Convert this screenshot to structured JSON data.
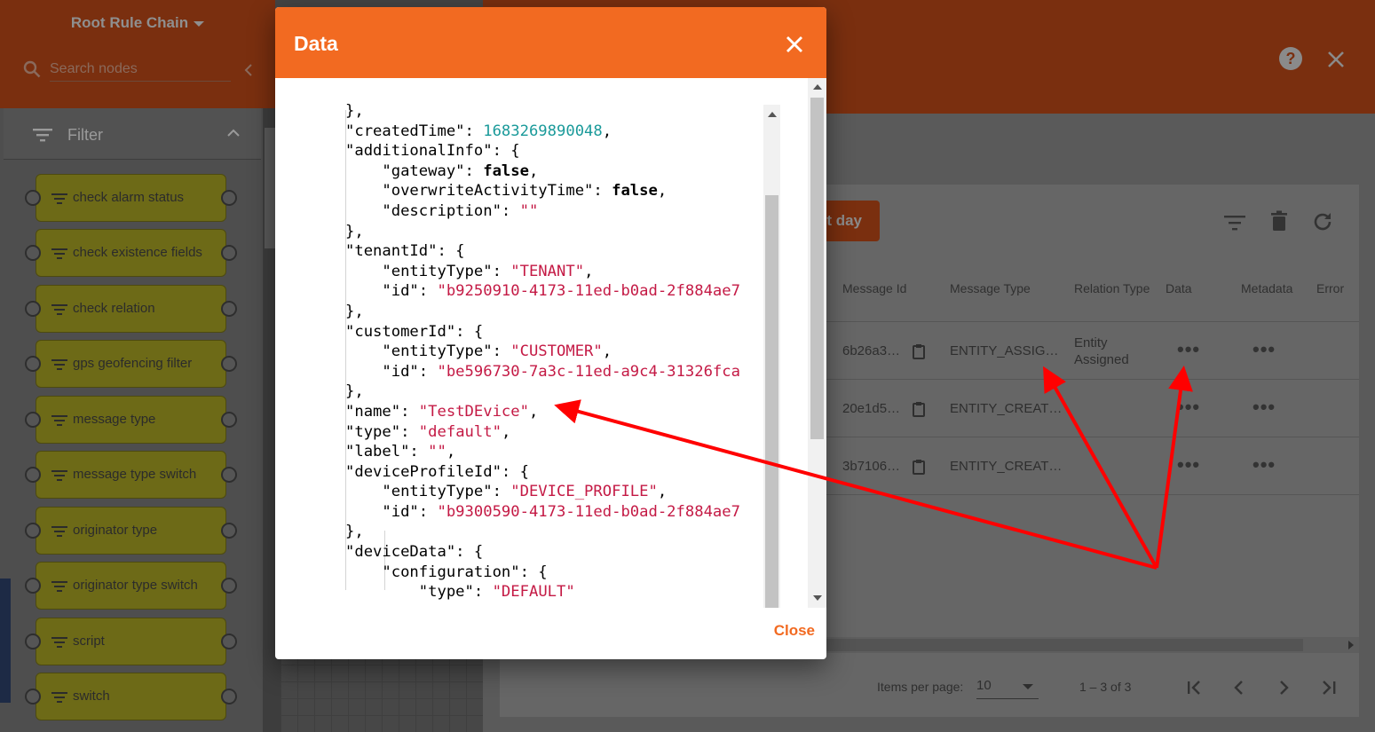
{
  "rule_chain": {
    "title": "Root Rule Chain",
    "search_placeholder": "Search nodes",
    "filter_label": "Filter",
    "nodes": [
      "check alarm status",
      "check existence fields",
      "check relation",
      "gps geofencing filter",
      "message type",
      "message type switch",
      "originator type",
      "originator type switch",
      "script",
      "switch"
    ]
  },
  "debug_panel": {
    "time_button": "t day",
    "columns": [
      "Message Id",
      "Message Type",
      "Relation Type",
      "Data",
      "Metadata",
      "Error"
    ],
    "rows": [
      {
        "message_id": "6b26a3…",
        "message_type": "ENTITY_ASSIG…",
        "relation_line1": "Entity",
        "relation_line2": "Assigned",
        "data": "•••",
        "metadata": "•••"
      },
      {
        "message_id": "20e1d5…",
        "message_type": "ENTITY_CREAT…",
        "relation_line1": "",
        "relation_line2": "",
        "data": "•••",
        "metadata": "•••"
      },
      {
        "message_id": "3b7106…",
        "message_type": "ENTITY_CREAT…",
        "relation_line1": "",
        "relation_line2": "",
        "data": "•••",
        "metadata": "•••"
      }
    ],
    "items_per_page_label": "Items per page:",
    "items_per_page_value": "10",
    "range_label": "1 – 3 of 3"
  },
  "modal": {
    "title": "Data",
    "close_label": "Close",
    "json_lines": [
      [
        {
          "t": "},"
        }
      ],
      [
        {
          "t": "\"createdTime\": "
        },
        {
          "t": "1683269890048",
          "c": "num"
        },
        {
          "t": ","
        }
      ],
      [
        {
          "t": "\"additionalInfo\": {"
        }
      ],
      [
        {
          "t": "    \"gateway\": "
        },
        {
          "t": "false",
          "c": "bool"
        },
        {
          "t": ","
        }
      ],
      [
        {
          "t": "    \"overwriteActivityTime\": "
        },
        {
          "t": "false",
          "c": "bool"
        },
        {
          "t": ","
        }
      ],
      [
        {
          "t": "    \"description\": "
        },
        {
          "t": "\"\"",
          "c": "str"
        }
      ],
      [
        {
          "t": "},"
        }
      ],
      [
        {
          "t": "\"tenantId\": {"
        }
      ],
      [
        {
          "t": "    \"entityType\": "
        },
        {
          "t": "\"TENANT\"",
          "c": "str"
        },
        {
          "t": ","
        }
      ],
      [
        {
          "t": "    \"id\": "
        },
        {
          "t": "\"b9250910-4173-11ed-b0ad-2f884ae7",
          "c": "str"
        }
      ],
      [
        {
          "t": "},"
        }
      ],
      [
        {
          "t": "\"customerId\": {"
        }
      ],
      [
        {
          "t": "    \"entityType\": "
        },
        {
          "t": "\"CUSTOMER\"",
          "c": "str"
        },
        {
          "t": ","
        }
      ],
      [
        {
          "t": "    \"id\": "
        },
        {
          "t": "\"be596730-7a3c-11ed-a9c4-31326fca",
          "c": "str"
        }
      ],
      [
        {
          "t": "},"
        }
      ],
      [
        {
          "t": "\"name\": "
        },
        {
          "t": "\"TestDEvice\"",
          "c": "str"
        },
        {
          "t": ","
        }
      ],
      [
        {
          "t": "\"type\": "
        },
        {
          "t": "\"default\"",
          "c": "str"
        },
        {
          "t": ","
        }
      ],
      [
        {
          "t": "\"label\": "
        },
        {
          "t": "\"\"",
          "c": "str"
        },
        {
          "t": ","
        }
      ],
      [
        {
          "t": "\"deviceProfileId\": {"
        }
      ],
      [
        {
          "t": "    \"entityType\": "
        },
        {
          "t": "\"DEVICE_PROFILE\"",
          "c": "str"
        },
        {
          "t": ","
        }
      ],
      [
        {
          "t": "    \"id\": "
        },
        {
          "t": "\"b9300590-4173-11ed-b0ad-2f884ae7",
          "c": "str"
        }
      ],
      [
        {
          "t": "},"
        }
      ],
      [
        {
          "t": "\"deviceData\": {"
        }
      ],
      [
        {
          "t": "    \"configuration\": {"
        }
      ],
      [
        {
          "t": "        \"type\": "
        },
        {
          "t": "\"DEFAULT\"",
          "c": "str"
        }
      ]
    ]
  },
  "colors": {
    "primary": "#f26a21",
    "json_number": "#1a9a9a",
    "json_string": "#c41a45",
    "annotation_arrow": "#ff0000"
  }
}
